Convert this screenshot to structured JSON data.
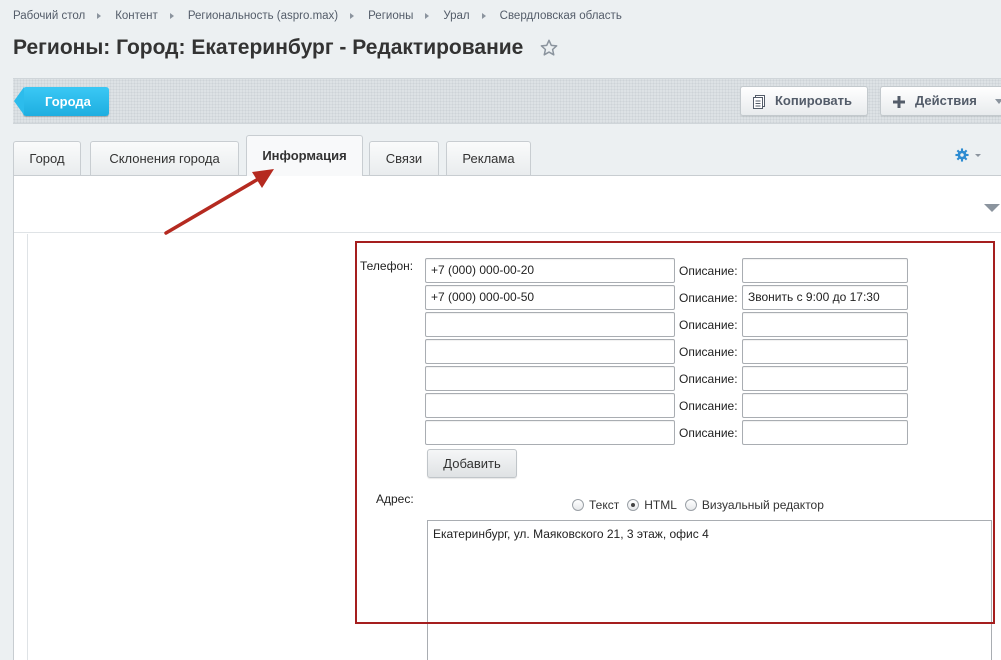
{
  "breadcrumb": [
    "Рабочий стол",
    "Контент",
    "Региональность (aspro.max)",
    "Регионы",
    "Урал",
    "Свердловская область"
  ],
  "page": {
    "title": "Регионы: Город: Екатеринбург - Редактирование"
  },
  "toolbar": {
    "back_label": "Города",
    "copy_label": "Копировать",
    "actions_label": "Действия"
  },
  "tabs": [
    "Город",
    "Склонения города",
    "Информация",
    "Связи",
    "Реклама"
  ],
  "active_tab": "Информация",
  "form": {
    "phone_label": "Телефон:",
    "desc_label": "Описание:",
    "phones": [
      {
        "number": "+7 (000) 000-00-20",
        "desc": ""
      },
      {
        "number": "+7 (000) 000-00-50",
        "desc": "Звонить с 9:00 до 17:30"
      },
      {
        "number": "",
        "desc": ""
      },
      {
        "number": "",
        "desc": ""
      },
      {
        "number": "",
        "desc": ""
      },
      {
        "number": "",
        "desc": ""
      },
      {
        "number": "",
        "desc": ""
      }
    ],
    "add_label": "Добавить",
    "address_label": "Адрес:",
    "modes": [
      "Текст",
      "HTML",
      "Визуальный редактор"
    ],
    "selected_mode": "HTML",
    "address_value": "Екатеринбург, ул. Маяковского 21, 3 этаж, офис 4"
  },
  "colors": {
    "accent": "#1eaee0",
    "highlight": "#a51e1e"
  }
}
